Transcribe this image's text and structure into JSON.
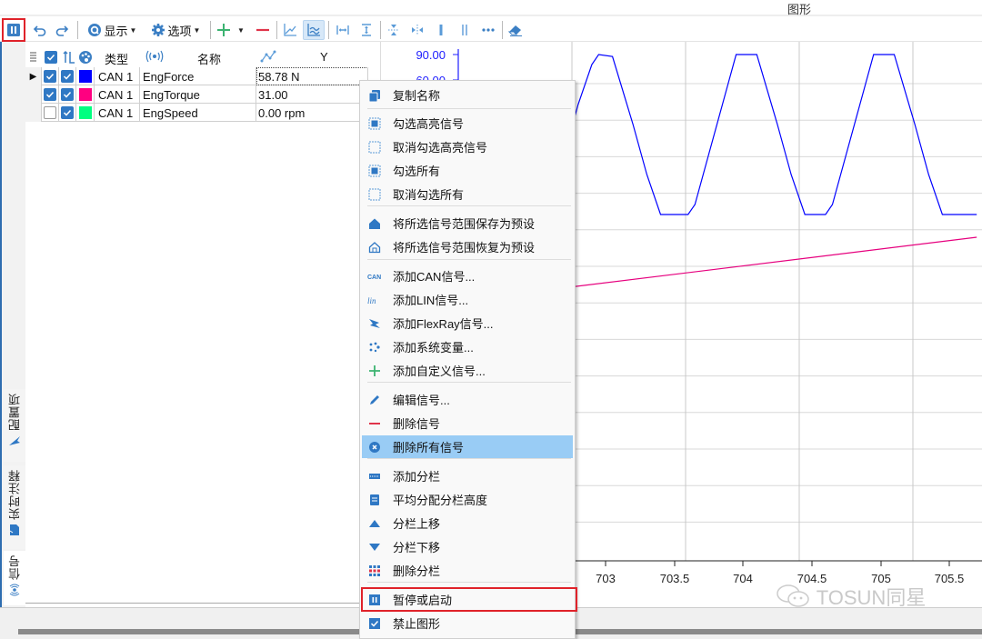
{
  "window": {
    "title": "图形"
  },
  "toolbar": {
    "pause_icon": "pause-icon",
    "undo_icon": "undo-icon",
    "redo_icon": "redo-icon",
    "display_label": "显示",
    "options_label": "选项",
    "add_icon": "plus-icon",
    "remove_icon": "minus-icon"
  },
  "vertical_tabs": [
    {
      "label": "配置项",
      "icon": "arrow-icon"
    },
    {
      "label": "实时注释",
      "icon": "note-icon"
    },
    {
      "label": "信号",
      "icon": "signal-icon"
    }
  ],
  "signal_table": {
    "headers": {
      "type": "类型",
      "name": "名称",
      "y": "Y"
    },
    "rows": [
      {
        "visible": true,
        "highlight": true,
        "color": "#0000ff",
        "type": "CAN 1",
        "name": "EngForce",
        "value": "58.78 N",
        "current": true
      },
      {
        "visible": true,
        "highlight": true,
        "color": "#ff0080",
        "type": "CAN 1",
        "name": "EngTorque",
        "value": "31.00",
        "current": false
      },
      {
        "visible": false,
        "highlight": true,
        "color": "#00ff80",
        "type": "CAN 1",
        "name": "EngSpeed",
        "value": "0.00 rpm",
        "current": false
      }
    ]
  },
  "context_menu": {
    "items": [
      {
        "label": "复制名称",
        "icon": "copy-icon"
      },
      {
        "sep": true
      },
      {
        "label": "勾选高亮信号",
        "icon": "select-filled-icon"
      },
      {
        "label": "取消勾选高亮信号",
        "icon": "select-empty-icon"
      },
      {
        "label": "勾选所有",
        "icon": "select-filled-icon"
      },
      {
        "label": "取消勾选所有",
        "icon": "select-empty-icon"
      },
      {
        "sep": true
      },
      {
        "label": "将所选信号范围保存为预设",
        "icon": "home-filled-icon"
      },
      {
        "label": "将所选信号范围恢复为预设",
        "icon": "home-outline-icon"
      },
      {
        "sep": true
      },
      {
        "label": "添加CAN信号...",
        "icon": "can-icon"
      },
      {
        "label": "添加LIN信号...",
        "icon": "lin-icon"
      },
      {
        "label": "添加FlexRay信号...",
        "icon": "flexray-icon"
      },
      {
        "label": "添加系统变量...",
        "icon": "dots-icon"
      },
      {
        "label": "添加自定义信号...",
        "icon": "plus-icon"
      },
      {
        "sep": true
      },
      {
        "label": "编辑信号...",
        "icon": "pencil-icon"
      },
      {
        "label": "删除信号",
        "icon": "minus-icon"
      },
      {
        "label": "删除所有信号",
        "icon": "close-circle-icon",
        "hover": true
      },
      {
        "sep": true
      },
      {
        "label": "添加分栏",
        "icon": "add-panel-icon"
      },
      {
        "label": "平均分配分栏高度",
        "icon": "distribute-icon"
      },
      {
        "label": "分栏上移",
        "icon": "triangle-up-icon"
      },
      {
        "label": "分栏下移",
        "icon": "triangle-down-icon"
      },
      {
        "label": "删除分栏",
        "icon": "grid-icon"
      },
      {
        "sep": true
      },
      {
        "label": "暂停或启动",
        "icon": "pause-icon",
        "outlined": true
      },
      {
        "label": "禁止图形",
        "icon": "check-icon"
      }
    ]
  },
  "chart_data": {
    "type": "line",
    "title": "",
    "xlabel": "",
    "ylabel": "",
    "x_ticks": [
      "703",
      "703.5",
      "704",
      "704.5",
      "705",
      "705.5"
    ],
    "y_tick_labels_visible": [
      "90.00",
      "60.00"
    ],
    "xlim": [
      702.52,
      705.7
    ],
    "grid": true,
    "series": [
      {
        "name": "EngForce",
        "color": "#0000ff",
        "shape": "periodic trapezoidal wave",
        "period": 1.0,
        "ymin_visible_row": 4.6,
        "ymax": 95,
        "points_x": [
          702.52,
          702.6,
          702.7,
          702.8,
          702.9,
          702.95,
          703.05,
          703.2,
          703.3,
          703.4,
          703.6,
          703.65,
          703.75,
          703.85,
          703.95,
          704.1,
          704.25,
          704.35,
          704.45,
          704.6,
          704.65,
          704.75,
          704.85,
          704.95,
          705.1,
          705.25,
          705.35,
          705.45,
          705.6,
          705.65,
          705.7
        ],
        "points_y": [
          15,
          20,
          45,
          70,
          90,
          95,
          94,
          60,
          35,
          15,
          15,
          20,
          45,
          70,
          95,
          95,
          60,
          35,
          15,
          15,
          20,
          45,
          70,
          95,
          95,
          60,
          35,
          15,
          15,
          15,
          15
        ]
      },
      {
        "name": "EngTorque",
        "color": "#e6007e",
        "shape": "slow linear ramp",
        "points_x": [
          702.52,
          705.7
        ],
        "points_y": [
          -14,
          6
        ]
      }
    ]
  },
  "watermark": "TOSUN同星"
}
